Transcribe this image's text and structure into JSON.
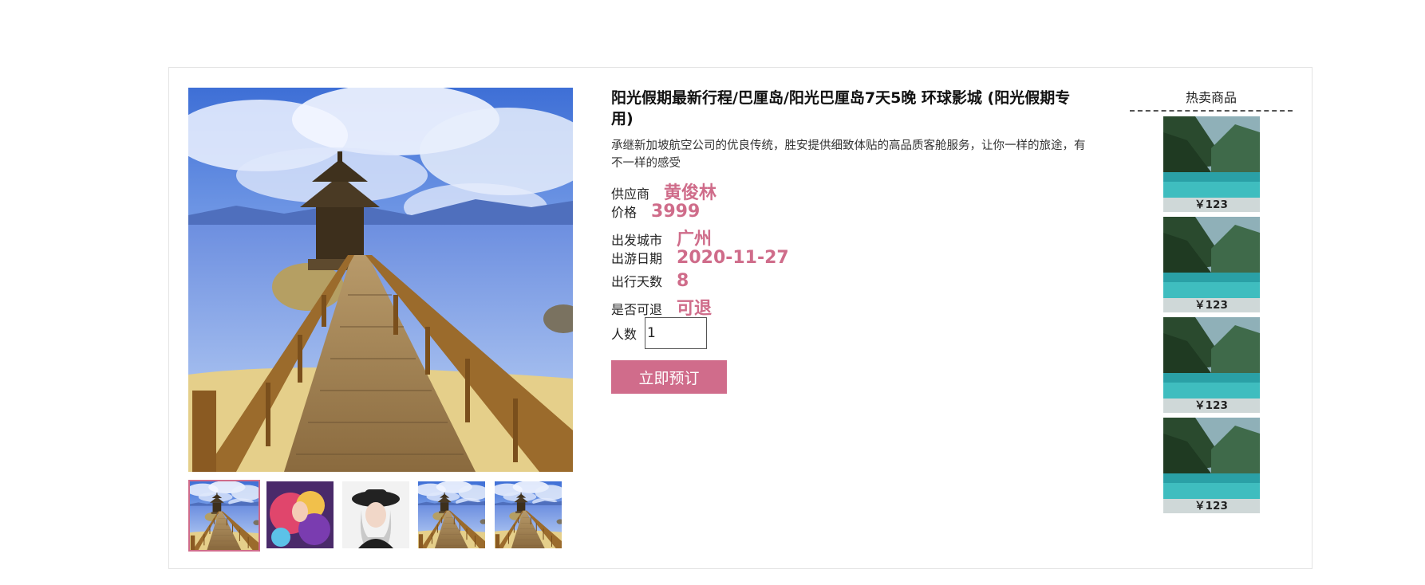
{
  "product": {
    "title": "阳光假期最新行程/巴厘岛/阳光巴厘岛7天5晚 环球影城 (阳光假期专用)",
    "description": "承继新加坡航空公司的优良传统，胜安提供细致体贴的高品质客舱服务，让你一样的旅途，有不一样的感受",
    "fields": [
      {
        "label": "供应商",
        "value": "黄俊林"
      },
      {
        "label": "价格",
        "value": "3999"
      },
      {
        "label": "出发城市",
        "value": "广州"
      },
      {
        "label": "出游日期",
        "value": "2020-11-27"
      },
      {
        "label": "出行天数",
        "value": "8"
      },
      {
        "label": "是否可退",
        "value": "可退"
      }
    ],
    "quantity_label": "人数",
    "quantity_value": "1",
    "book_button": "立即预订"
  },
  "gallery": {
    "thumbnails": [
      {
        "icon": "pier-photo-icon",
        "active": true
      },
      {
        "icon": "game-art-icon",
        "active": false
      },
      {
        "icon": "portrait-photo-icon",
        "active": false
      },
      {
        "icon": "pier-photo-icon",
        "active": false
      },
      {
        "icon": "pier-photo-icon",
        "active": false
      }
    ]
  },
  "hot_sales": {
    "title": "热卖商品",
    "items": [
      {
        "price": "￥123"
      },
      {
        "price": "￥123"
      },
      {
        "price": "￥123"
      },
      {
        "price": "￥123"
      }
    ]
  },
  "colors": {
    "accent": "#d06c8b",
    "value_text": "#cf6c8a",
    "price_bar": "#cfd8d8"
  }
}
